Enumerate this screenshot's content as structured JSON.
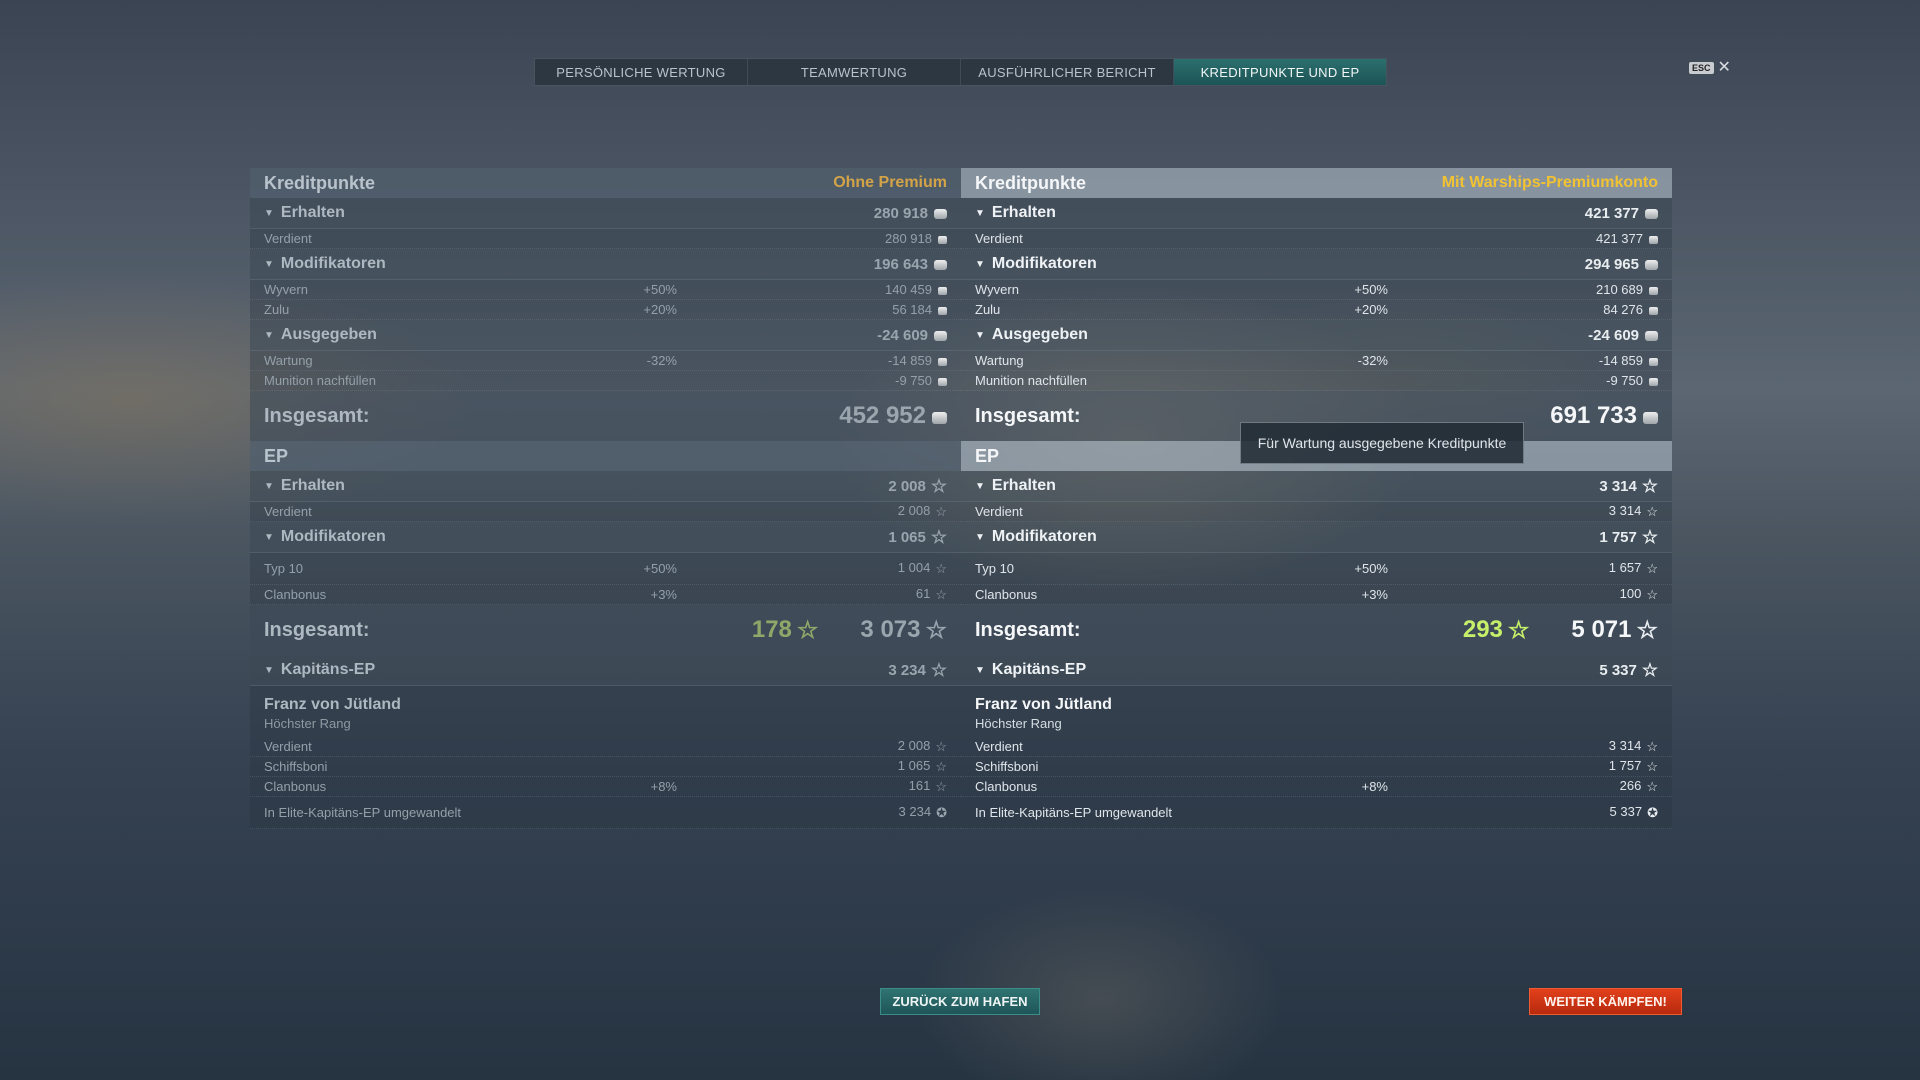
{
  "tabs": [
    {
      "label": "PERSÖNLICHE WERTUNG"
    },
    {
      "label": "TEAMWERTUNG"
    },
    {
      "label": "AUSFÜHRLICHER BERICHT"
    },
    {
      "label": "KREDITPUNKTE UND EP"
    }
  ],
  "esc": {
    "key": "ESC",
    "close": "✕"
  },
  "left": {
    "credits": {
      "title": "Kreditpunkte",
      "badge": "Ohne Premium",
      "received": {
        "label": "Erhalten",
        "value": "280 918"
      },
      "earned": {
        "label": "Verdient",
        "value": "280 918"
      },
      "modifiers": {
        "label": "Modifikatoren",
        "value": "196 643"
      },
      "wyvern": {
        "label": "Wyvern",
        "pct": "+50%",
        "value": "140 459"
      },
      "zulu": {
        "label": "Zulu",
        "pct": "+20%",
        "value": "56 184"
      },
      "spent": {
        "label": "Ausgegeben",
        "value": "-24 609"
      },
      "maintenance": {
        "label": "Wartung",
        "pct": "-32%",
        "value": "-14 859"
      },
      "ammo": {
        "label": "Munition nachfüllen",
        "value": "-9 750"
      },
      "total": {
        "label": "Insgesamt:",
        "value": "452 952"
      }
    },
    "xp": {
      "title": "EP",
      "received": {
        "label": "Erhalten",
        "value": "2 008"
      },
      "earned": {
        "label": "Verdient",
        "value": "2 008"
      },
      "modifiers": {
        "label": "Modifikatoren",
        "value": "1 065"
      },
      "type10": {
        "label": "Typ 10",
        "pct": "+50%",
        "value": "1 004"
      },
      "clan": {
        "label": "Clanbonus",
        "pct": "+3%",
        "value": "61"
      },
      "total": {
        "label": "Insgesamt:",
        "bonus": "178",
        "value": "3 073"
      }
    },
    "captain": {
      "head": {
        "label": "Kapitäns-EP",
        "value": "3 234"
      },
      "name": "Franz von Jütland",
      "rank": "Höchster Rang",
      "earned": {
        "label": "Verdient",
        "value": "2 008"
      },
      "ship": {
        "label": "Schiffsboni",
        "value": "1 065"
      },
      "clan": {
        "label": "Clanbonus",
        "pct": "+8%",
        "value": "161"
      },
      "elite": {
        "label": "In Elite-Kapitäns-EP umgewandelt",
        "value": "3 234"
      }
    }
  },
  "right": {
    "credits": {
      "title": "Kreditpunkte",
      "badge": "Mit Warships-Premiumkonto",
      "received": {
        "label": "Erhalten",
        "value": "421 377"
      },
      "earned": {
        "label": "Verdient",
        "value": "421 377"
      },
      "modifiers": {
        "label": "Modifikatoren",
        "value": "294 965"
      },
      "wyvern": {
        "label": "Wyvern",
        "pct": "+50%",
        "value": "210 689"
      },
      "zulu": {
        "label": "Zulu",
        "pct": "+20%",
        "value": "84 276"
      },
      "spent": {
        "label": "Ausgegeben",
        "value": "-24 609"
      },
      "maintenance": {
        "label": "Wartung",
        "pct": "-32%",
        "value": "-14 859"
      },
      "ammo": {
        "label": "Munition nachfüllen",
        "value": "-9 750"
      },
      "total": {
        "label": "Insgesamt:",
        "value": "691 733"
      }
    },
    "xp": {
      "title": "EP",
      "received": {
        "label": "Erhalten",
        "value": "3 314"
      },
      "earned": {
        "label": "Verdient",
        "value": "3 314"
      },
      "modifiers": {
        "label": "Modifikatoren",
        "value": "1 757"
      },
      "type10": {
        "label": "Typ 10",
        "pct": "+50%",
        "value": "1 657"
      },
      "clan": {
        "label": "Clanbonus",
        "pct": "+3%",
        "value": "100"
      },
      "total": {
        "label": "Insgesamt:",
        "bonus": "293",
        "value": "5 071"
      }
    },
    "captain": {
      "head": {
        "label": "Kapitäns-EP",
        "value": "5 337"
      },
      "name": "Franz von Jütland",
      "rank": "Höchster Rang",
      "earned": {
        "label": "Verdient",
        "value": "3 314"
      },
      "ship": {
        "label": "Schiffsboni",
        "value": "1 757"
      },
      "clan": {
        "label": "Clanbonus",
        "pct": "+8%",
        "value": "266"
      },
      "elite": {
        "label": "In Elite-Kapitäns-EP umgewandelt",
        "value": "5 337"
      }
    }
  },
  "tooltip": "Für Wartung ausgegebene Kreditpunkte",
  "buttons": {
    "back": "ZURÜCK ZUM HAFEN",
    "fight": "WEITER KÄMPFEN!"
  },
  "icons": {
    "credit": "credit-coin-icon",
    "xp": "star-icon",
    "elite": "elite-captain-icon"
  }
}
